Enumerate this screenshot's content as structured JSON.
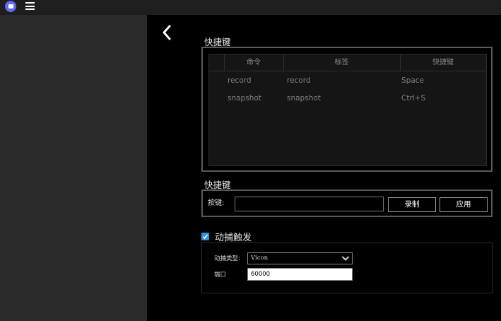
{
  "topbar": {
    "app_icon": "app-logo-icon",
    "menu_icon": "hamburger-menu-icon"
  },
  "back": {
    "icon": "chevron-left-icon"
  },
  "shortcuts_table": {
    "title": "快捷键",
    "columns": [
      "命令",
      "标签",
      "快捷键"
    ],
    "rows": [
      {
        "command": "record",
        "label": "record",
        "shortcut": "Space"
      },
      {
        "command": "snapshot",
        "label": "snapshot",
        "shortcut": "Ctrl+S"
      }
    ]
  },
  "shortcut_editor": {
    "title": "快捷键",
    "key_label": "按键:",
    "key_value": "",
    "record_button": "录制",
    "apply_button": "应用"
  },
  "mocap": {
    "enabled": true,
    "title": "动捕触发",
    "type_label": "动捕类型:",
    "type_value": "Vicon",
    "port_label": "端口",
    "port_value": "60000"
  },
  "colors": {
    "accent": "#2f8fe6",
    "app_icon": "#5f6bf0",
    "sidebar": "#2a2a2a",
    "topbar": "#1e1e1e"
  }
}
